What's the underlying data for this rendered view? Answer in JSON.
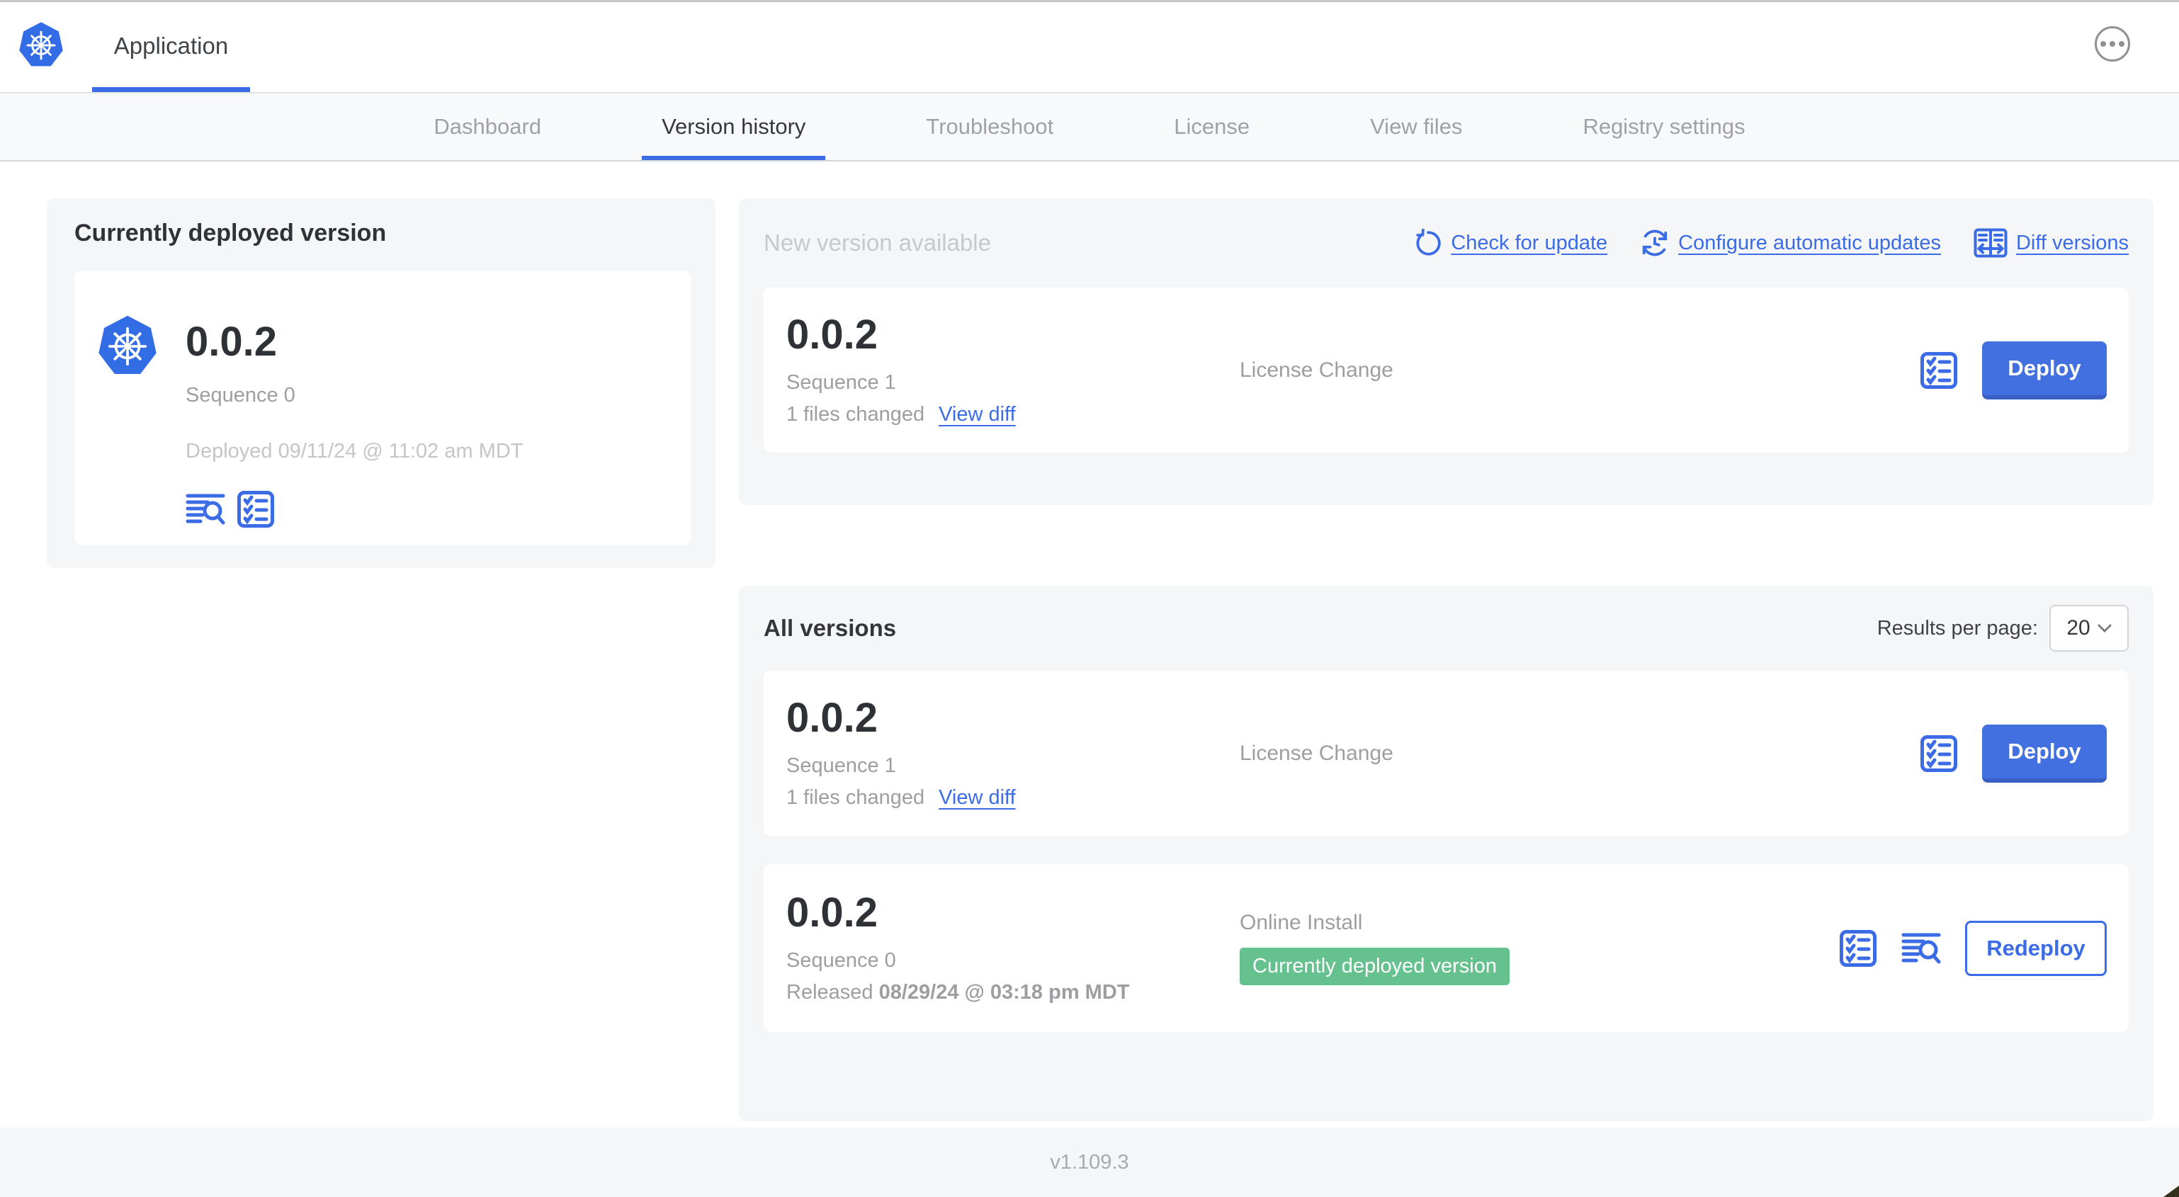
{
  "colors": {
    "accent_blue": "#3b6ce5",
    "button_blue": "#4370e0",
    "badge_green": "#65c18e",
    "panel_gray": "#f5f6f8",
    "text_dark": "#33373b",
    "text_gray": "#9c9ea1"
  },
  "header": {
    "title": "Application"
  },
  "nav": {
    "tabs": [
      {
        "label": "Dashboard"
      },
      {
        "label": "Version history"
      },
      {
        "label": "Troubleshoot"
      },
      {
        "label": "License"
      },
      {
        "label": "View files"
      },
      {
        "label": "Registry settings"
      }
    ],
    "active_tab": "Version history"
  },
  "current_version": {
    "panel_title": "Currently deployed version",
    "version": "0.0.2",
    "sequence": "Sequence 0",
    "deployed": "Deployed 09/11/24 @ 11:02 am MDT"
  },
  "new_version": {
    "panel_title": "New version available",
    "actions": {
      "check": "Check for update",
      "configure": "Configure automatic updates",
      "diff": "Diff versions"
    },
    "card": {
      "version": "0.0.2",
      "sequence": "Sequence 1",
      "files_changed": "1 files changed",
      "view_diff": "View diff",
      "source": "License Change",
      "deploy": "Deploy"
    }
  },
  "all_versions": {
    "panel_title": "All versions",
    "results_label": "Results per page:",
    "results_value": "20",
    "rows": [
      {
        "version": "0.0.2",
        "sequence": "Sequence 1",
        "files_changed": "1 files changed",
        "view_diff": "View diff",
        "source": "License Change",
        "action": "Deploy"
      },
      {
        "version": "0.0.2",
        "sequence": "Sequence 0",
        "released_prefix": "Released",
        "released_date": "08/29/24 @ 03:18 pm MDT",
        "source": "Online Install",
        "badge": "Currently deployed version",
        "action": "Redeploy"
      }
    ]
  },
  "footer": {
    "app_version": "v1.109.3"
  }
}
